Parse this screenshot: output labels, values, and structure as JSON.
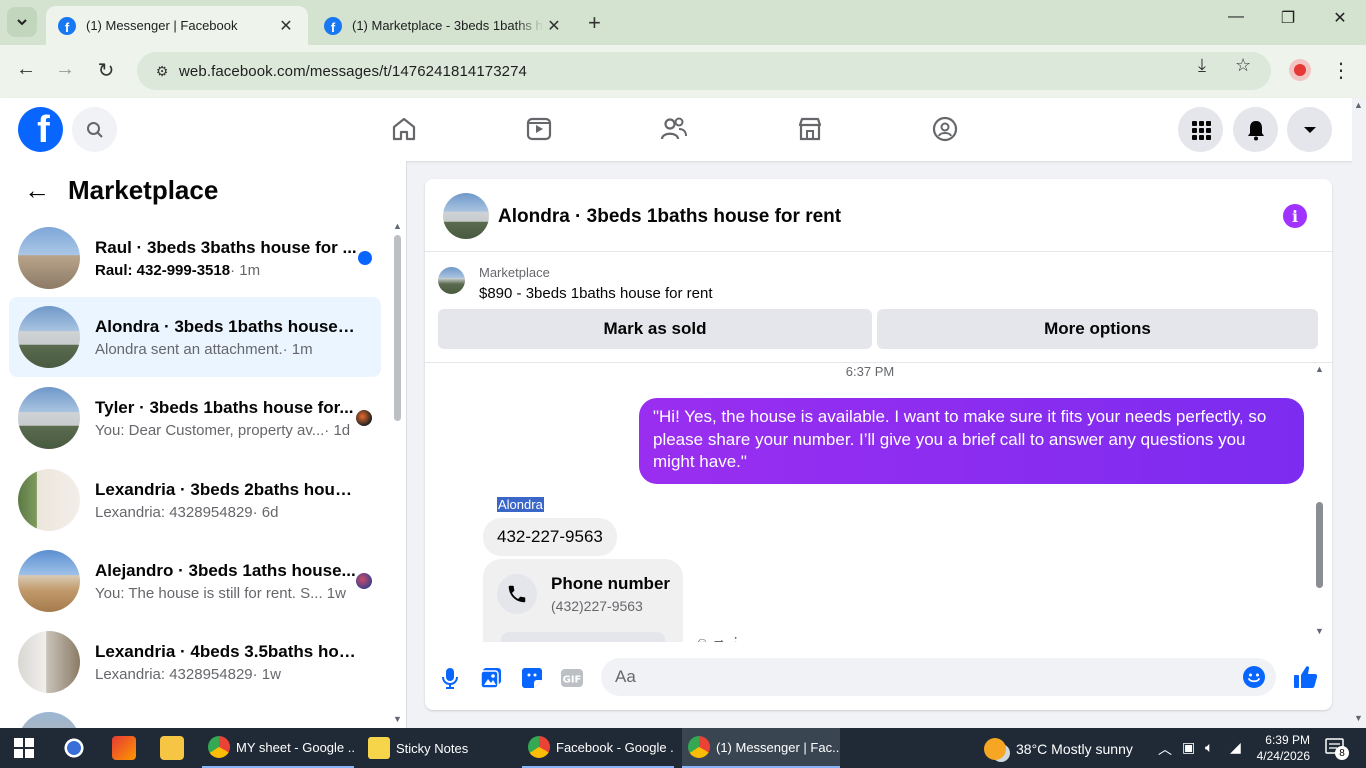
{
  "browser": {
    "tabs": [
      {
        "title": "(1) Messenger | Facebook",
        "active": true
      },
      {
        "title": "(1) Marketplace - 3beds 1baths ho",
        "active": false
      }
    ],
    "url": "web.facebook.com/messages/t/1476241814173274"
  },
  "sidebar": {
    "title": "Marketplace",
    "conversations": [
      {
        "title": "Raul · 3beds 3baths house for ...",
        "preview": "Raul: 432-999-3518",
        "age": "· 1m",
        "unread": true
      },
      {
        "title": "Alondra · 3beds 1baths house fo...",
        "preview": "Alondra sent an attachment.",
        "age": "· 1m",
        "selected": true
      },
      {
        "title": "Tyler · 3beds 1baths house for...",
        "preview": "You: Dear Customer, property av...",
        "age": "· 1d"
      },
      {
        "title": "Lexandria · 3beds 2baths house ...",
        "preview": "Lexandria: 4328954829",
        "age": "· 6d"
      },
      {
        "title": "Alejandro · 3beds 1aths house...",
        "preview": "You: The house is still for rent. S...",
        "age": "1w"
      },
      {
        "title": "Lexandria · 4beds 3.5baths hous...",
        "preview": "Lexandria: 4328954829",
        "age": "· 1w"
      }
    ]
  },
  "chat": {
    "title": "Alondra · 3beds 1baths house for rent",
    "listing": {
      "label": "Marketplace",
      "detail": "$890 - 3beds 1baths house for rent",
      "mark_sold": "Mark as sold",
      "more_options": "More options"
    },
    "timestamp": "6:37 PM",
    "outgoing_message": "\"Hi! Yes, the house is available. I want to make sure it fits your needs perfectly, so please share your number. I’ll give you a brief call to answer any questions you might have.\"",
    "sender_name": "Alondra",
    "incoming_message": "432-227-9563",
    "contact_card": {
      "heading": "Phone number",
      "number": "(432)227-9563"
    },
    "composer_placeholder": "Aa"
  },
  "taskbar": {
    "apps": [
      {
        "label": "MY sheet - Google ..."
      },
      {
        "label": "Sticky Notes"
      },
      {
        "label": "Facebook - Google ..."
      },
      {
        "label": "(1) Messenger | Fac..."
      }
    ],
    "weather": "38°C  Mostly sunny",
    "time": "6:39 PM",
    "date": "4/24/2026",
    "notifications": "8"
  },
  "colors": {
    "fb_blue": "#0866ff",
    "bubble_purple": "#8a2fe8",
    "chrome_green": "#d3e3d0"
  }
}
